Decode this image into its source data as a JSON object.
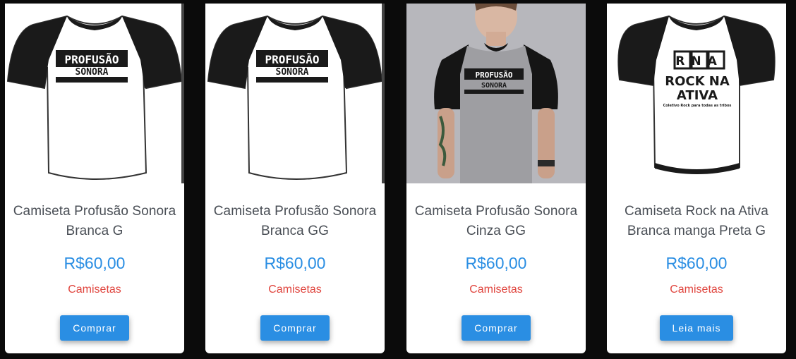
{
  "products": [
    {
      "title": "Camiseta Profusão Sonora Branca G",
      "price": "R$60,00",
      "category": "Camisetas",
      "button": "Comprar",
      "image": {
        "kind": "tshirt-white-black-sleeves",
        "print_top": "PROFUSÃO",
        "print_bottom": "SONORA"
      }
    },
    {
      "title": "Camiseta Profusão Sonora Branca GG",
      "price": "R$60,00",
      "category": "Camisetas",
      "button": "Comprar",
      "image": {
        "kind": "tshirt-white-black-sleeves",
        "print_top": "PROFUSÃO",
        "print_bottom": "SONORA"
      }
    },
    {
      "title": "Camiseta Profusão Sonora Cinza GG",
      "price": "R$60,00",
      "category": "Camisetas",
      "button": "Comprar",
      "image": {
        "kind": "model-photo-grey-raglan",
        "print_top": "PROFUSÃO",
        "print_bottom": "SONORA"
      }
    },
    {
      "title": "Camiseta Rock na Ativa Branca manga Preta G",
      "price": "R$60,00",
      "category": "Camisetas",
      "button": "Leia mais",
      "image": {
        "kind": "tshirt-white-black-sleeves",
        "print_top": "RNA",
        "print_middle": "ROCK NA",
        "print_bottom": "ATIVA",
        "print_tagline": "Coletivo Rock para todas as tribos"
      }
    }
  ],
  "colors": {
    "accent": "#2a8ee3",
    "category": "#e0453e",
    "title": "#4a4f56",
    "background": "#0b0b0b"
  }
}
